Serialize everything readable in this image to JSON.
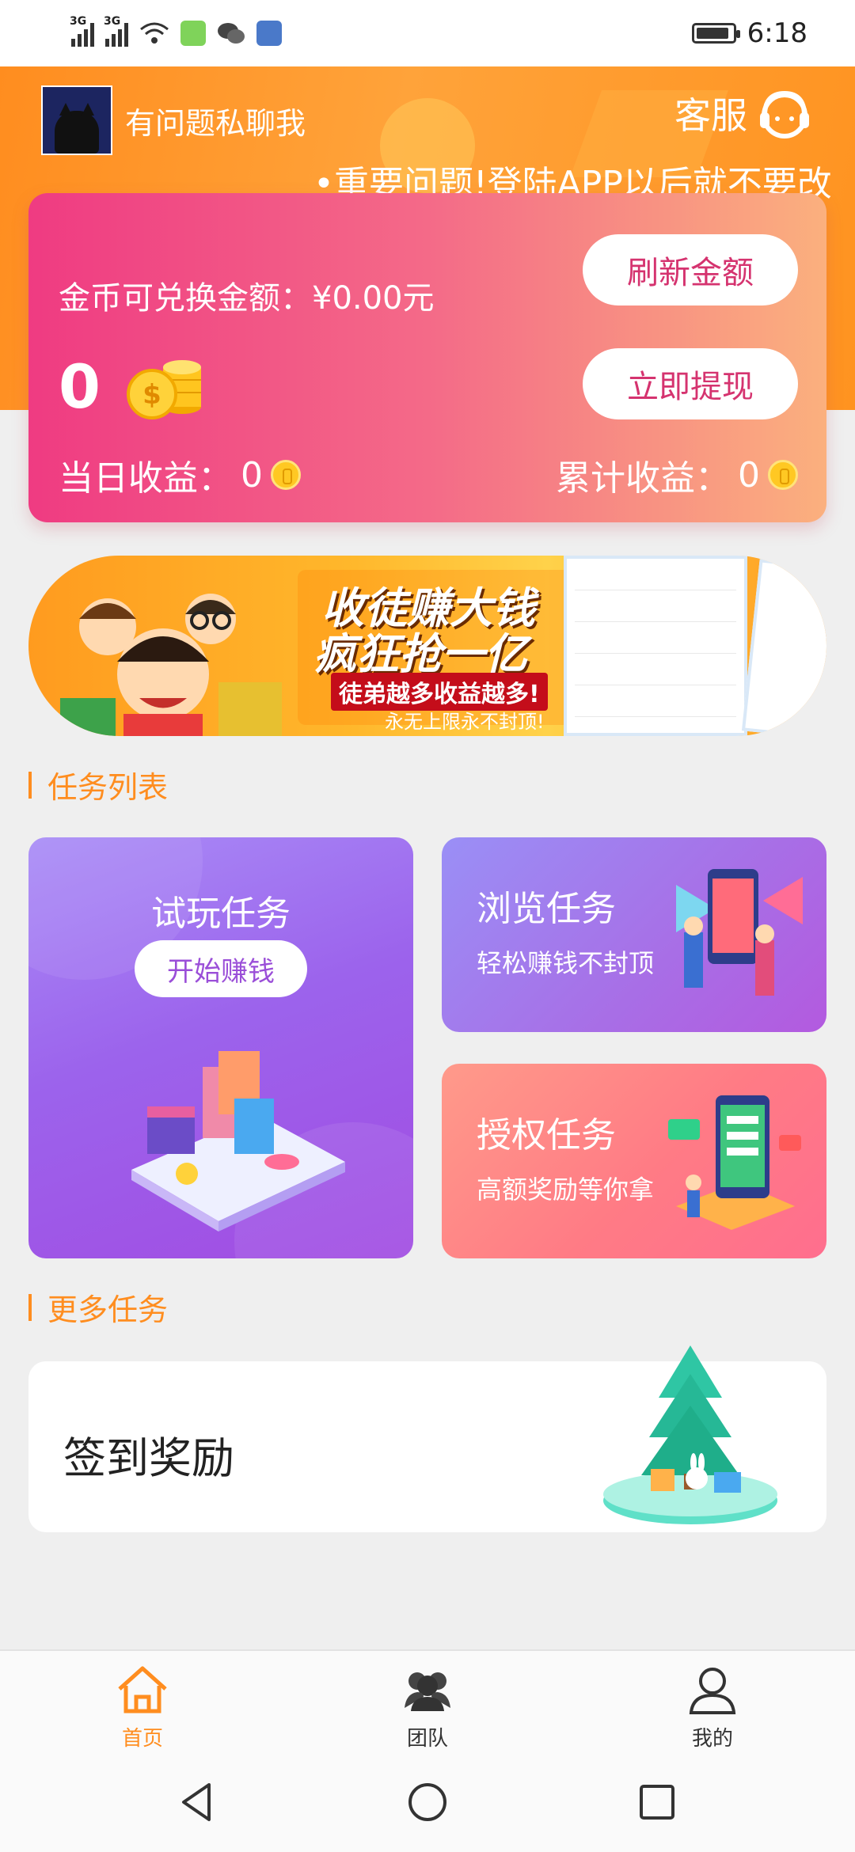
{
  "status_bar": {
    "network1": "3G",
    "network2": "3G",
    "time": "6:18"
  },
  "header": {
    "user_name": "有问题私聊我",
    "customer_service": "客服",
    "notice": "•重要问题!登陆APP以后就不要改"
  },
  "wallet": {
    "exchange_label": "金币可兑换金额：¥0.00元",
    "coins": "0",
    "refresh_button": "刷新金额",
    "withdraw_button": "立即提现",
    "today_label": "当日收益：",
    "today_value": "0",
    "total_label": "累计收益：",
    "total_value": "0"
  },
  "banner": {
    "title_line1": "收徒赚大钱",
    "title_line2": "疯狂抢一亿",
    "sub_line1": "徒弟越多收益越多!",
    "sub_line2": "永无上限永不封顶!"
  },
  "tasks": {
    "section_title": "任务列表",
    "trial": {
      "title": "试玩任务",
      "button": "开始赚钱"
    },
    "browse": {
      "title": "浏览任务",
      "subtitle": "轻松赚钱不封顶"
    },
    "auth": {
      "title": "授权任务",
      "subtitle": "高额奖励等你拿"
    }
  },
  "more": {
    "section_title": "更多任务",
    "signin_title": "签到奖励"
  },
  "tabbar": {
    "items": [
      {
        "label": "首页",
        "icon": "home-icon",
        "active": true
      },
      {
        "label": "团队",
        "icon": "team-icon",
        "active": false
      },
      {
        "label": "我的",
        "icon": "profile-icon",
        "active": false
      }
    ]
  },
  "colors": {
    "brand_orange": "#ff8d1f",
    "wallet_pink": "#ef3b82",
    "trial_purple": "#9c63ec",
    "auth_coral": "#ff7b85"
  }
}
